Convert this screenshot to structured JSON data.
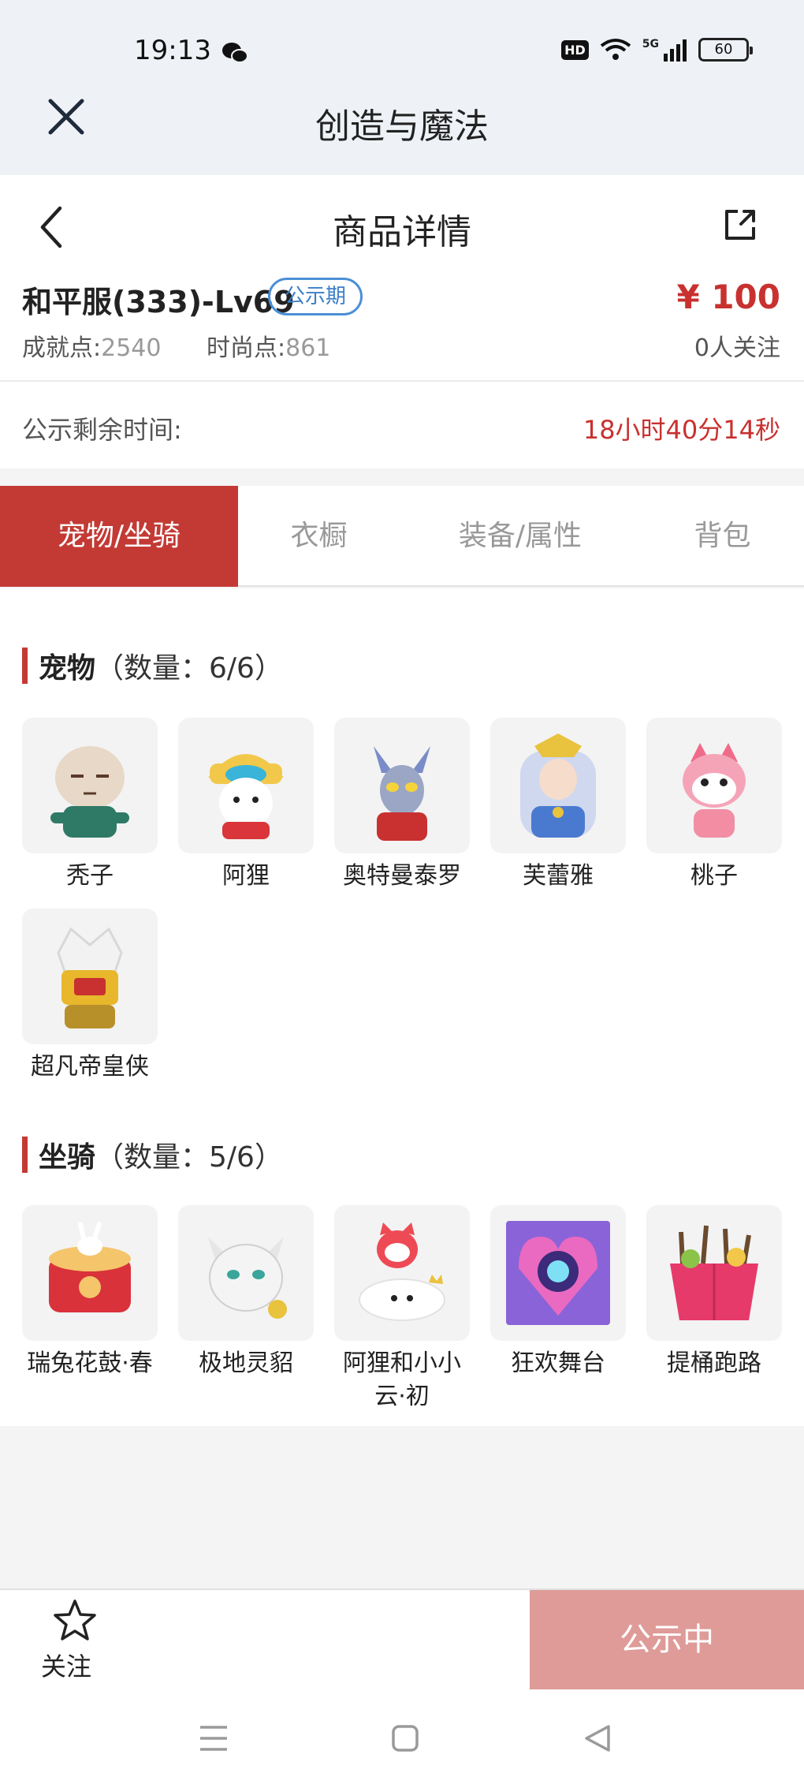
{
  "status_bar": {
    "time": "19:13",
    "hd": "HD",
    "network": "5G",
    "battery": "60"
  },
  "miniapp": {
    "title": "创造与魔法"
  },
  "nav": {
    "title": "商品详情"
  },
  "product": {
    "name": "和平服(333)-Lv69",
    "badge": "公示期",
    "price": "¥ 100",
    "achievement_label": "成就点:",
    "achievement_value": "2540",
    "fashion_label": "时尚点:",
    "fashion_value": "861",
    "followers": "0人关注"
  },
  "remain": {
    "label": "公示剩余时间:",
    "value": "18小时40分14秒"
  },
  "tabs": [
    {
      "label": "宠物/坐骑",
      "active": true
    },
    {
      "label": "衣橱",
      "active": false
    },
    {
      "label": "装备/属性",
      "active": false
    },
    {
      "label": "背包",
      "active": false
    }
  ],
  "pets": {
    "title": "宠物",
    "count": "（数量：6/6）",
    "items": [
      {
        "name": "秃子",
        "icon": "bald-boy-icon"
      },
      {
        "name": "阿狸",
        "icon": "ali-fox-icon"
      },
      {
        "name": "奥特曼泰罗",
        "icon": "ultraman-icon"
      },
      {
        "name": "芙蕾雅",
        "icon": "freya-icon"
      },
      {
        "name": "桃子",
        "icon": "peach-cat-icon"
      },
      {
        "name": "超凡帝皇侠",
        "icon": "emperor-armor-icon"
      }
    ]
  },
  "mounts": {
    "title": "坐骑",
    "count": "（数量：5/6）",
    "items": [
      {
        "name": "瑞兔花鼓·春",
        "icon": "rabbit-drum-icon"
      },
      {
        "name": "极地灵貂",
        "icon": "polar-mink-icon"
      },
      {
        "name": "阿狸和小小云·初",
        "icon": "ali-cloud-icon"
      },
      {
        "name": "狂欢舞台",
        "icon": "carnival-stage-icon"
      },
      {
        "name": "提桶跑路",
        "icon": "bucket-run-icon"
      }
    ]
  },
  "bottom": {
    "follow_label": "关注",
    "cta_label": "公示中"
  },
  "colors": {
    "accent": "#c33a35",
    "price": "#c8312f",
    "badge": "#4b8fd6",
    "cta_disabled": "#de9b98"
  }
}
